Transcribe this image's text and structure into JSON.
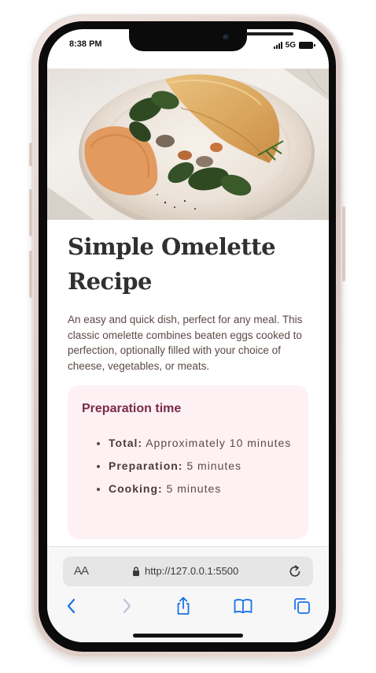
{
  "status_bar": {
    "time": "8:38 PM",
    "network": "5G",
    "icons": [
      "signal-icon",
      "battery-icon"
    ]
  },
  "recipe": {
    "title": "Simple Omelette Recipe",
    "description": "An easy and quick dish, perfect for any meal. This classic omelette combines beaten eggs cooked to perfection, optionally filled with your choice of cheese, vegetables, or meats.",
    "preparation": {
      "heading": "Preparation time",
      "items": [
        {
          "label": "Total:",
          "value": "Approximately 10 minutes"
        },
        {
          "label": "Preparation:",
          "value": "5 minutes"
        },
        {
          "label": "Cooking:",
          "value": "5 minutes"
        }
      ]
    }
  },
  "browser": {
    "text_size_label": "AA",
    "url": "http://127.0.0.1:5500",
    "toolbar_icons": [
      "back-icon",
      "forward-icon",
      "share-icon",
      "bookmarks-icon",
      "tabs-icon"
    ]
  },
  "colors": {
    "title": "#303030",
    "accent": "#7a2a4a",
    "card_background": "#fdf1f4",
    "body_text": "#5a4a45",
    "link_blue": "#1a73e8"
  }
}
